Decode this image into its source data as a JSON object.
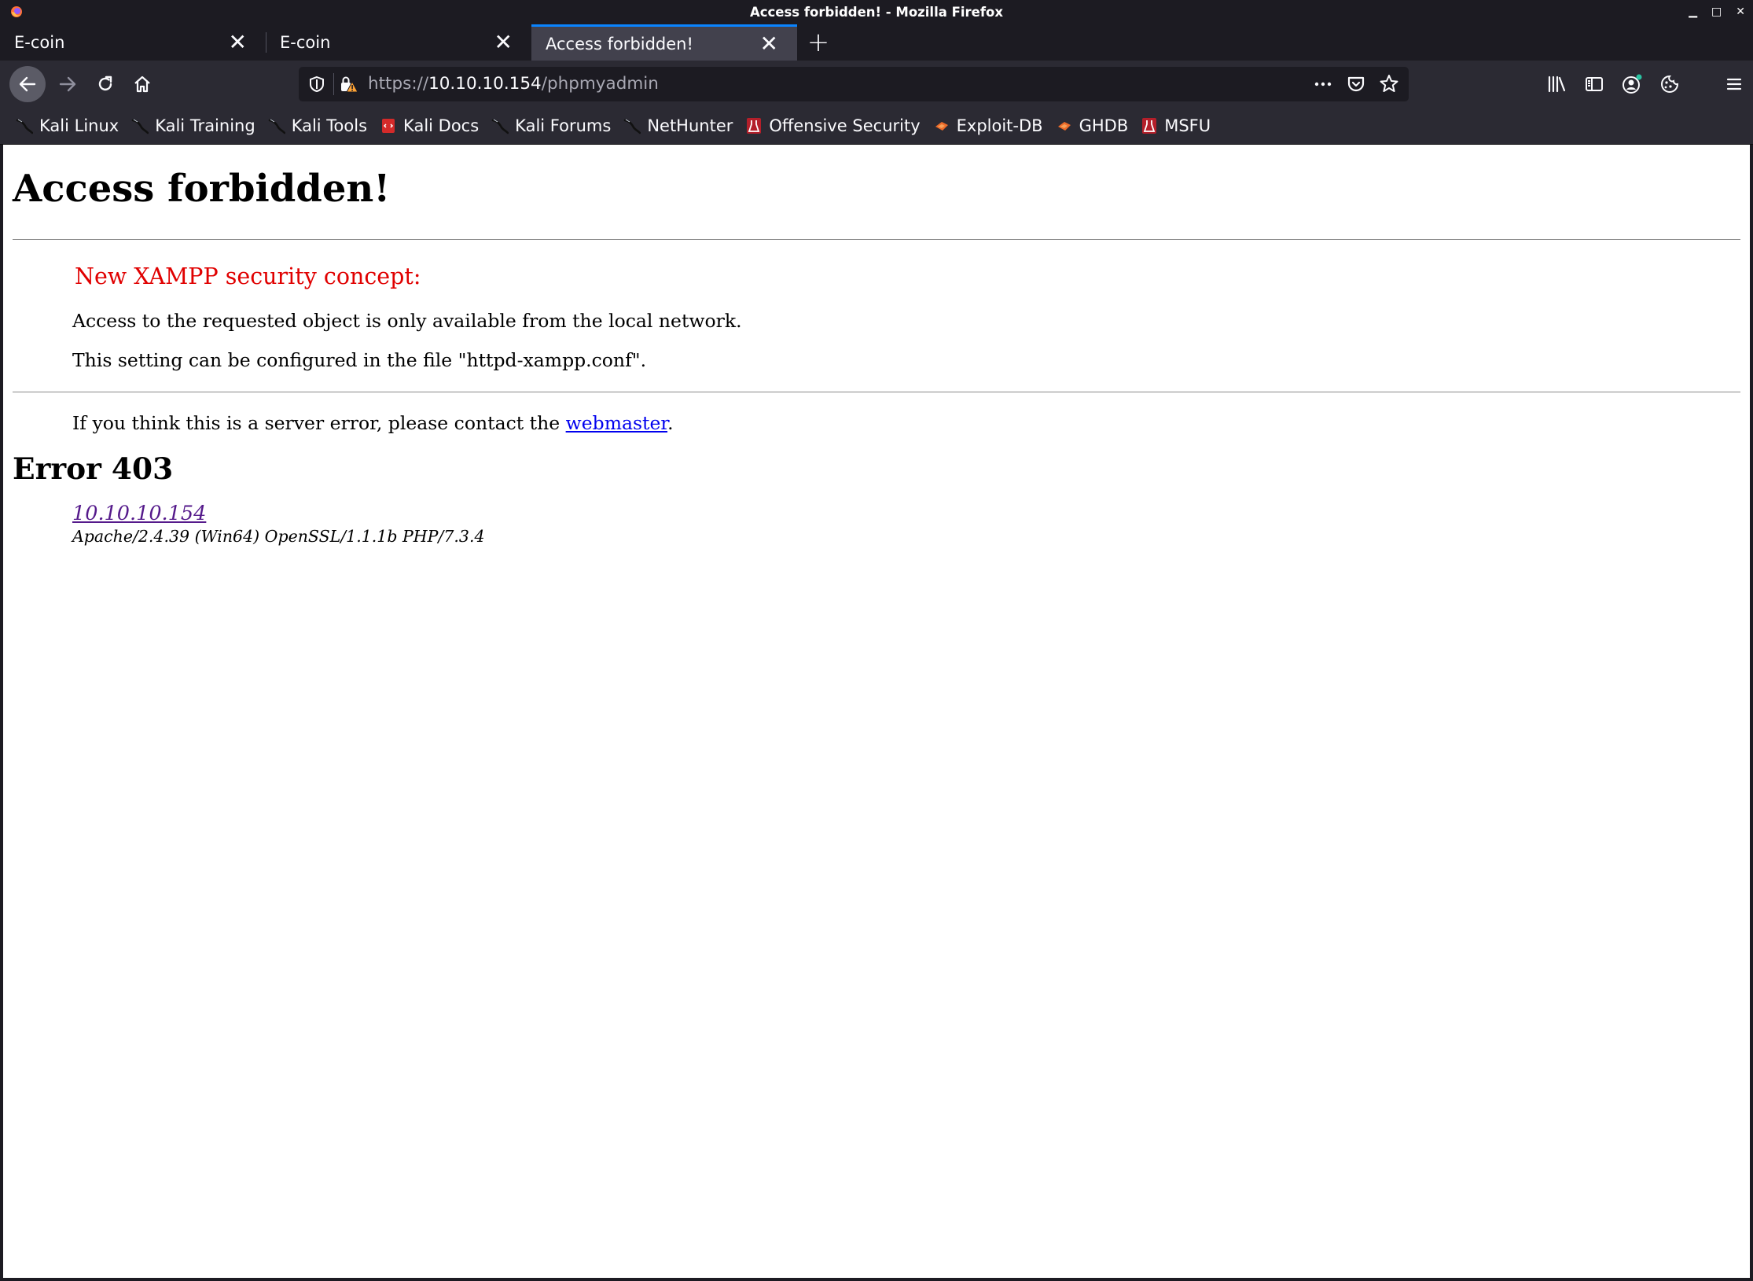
{
  "window": {
    "title": "Access forbidden! - Mozilla Firefox",
    "controls": [
      "minimize",
      "maximize",
      "close"
    ]
  },
  "tabs": [
    {
      "label": "E-coin",
      "active": false
    },
    {
      "label": "E-coin",
      "active": false
    },
    {
      "label": "Access forbidden!",
      "active": true
    }
  ],
  "tab_close_glyph": "✕",
  "new_tab_glyph": "+",
  "urlbar": {
    "protocol": "https://",
    "host": "10.10.10.154",
    "path": "/phpmyadmin"
  },
  "bookmarks": [
    {
      "label": "Kali Linux",
      "icon": "kali-dragon-icon"
    },
    {
      "label": "Kali Training",
      "icon": "kali-dragon-icon"
    },
    {
      "label": "Kali Tools",
      "icon": "kali-dragon-icon"
    },
    {
      "label": "Kali Docs",
      "icon": "kali-docs-icon"
    },
    {
      "label": "Kali Forums",
      "icon": "kali-dragon-icon"
    },
    {
      "label": "NetHunter",
      "icon": "kali-dragon-icon"
    },
    {
      "label": "Offensive Security",
      "icon": "offsec-icon"
    },
    {
      "label": "Exploit-DB",
      "icon": "exploit-db-icon"
    },
    {
      "label": "GHDB",
      "icon": "exploit-db-icon"
    },
    {
      "label": "MSFU",
      "icon": "offsec-icon"
    }
  ],
  "page": {
    "heading": "Access forbidden!",
    "concept": "New XAMPP security concept:",
    "line1": "Access to the requested object is only available from the local network.",
    "line2": "This setting can be configured in the file \"httpd-xampp.conf\".",
    "contact_prefix": "If you think this is a server error, please contact the ",
    "contact_link": "webmaster",
    "contact_suffix": ".",
    "error_heading": "Error 403",
    "address_link": "10.10.10.154",
    "server_signature": "Apache/2.4.39 (Win64) OpenSSL/1.1.1b PHP/7.3.4"
  },
  "colors": {
    "accent": "#0a84ff",
    "concept_red": "#e00000",
    "link_blue": "#0000ee",
    "link_visited": "#551a8b"
  }
}
